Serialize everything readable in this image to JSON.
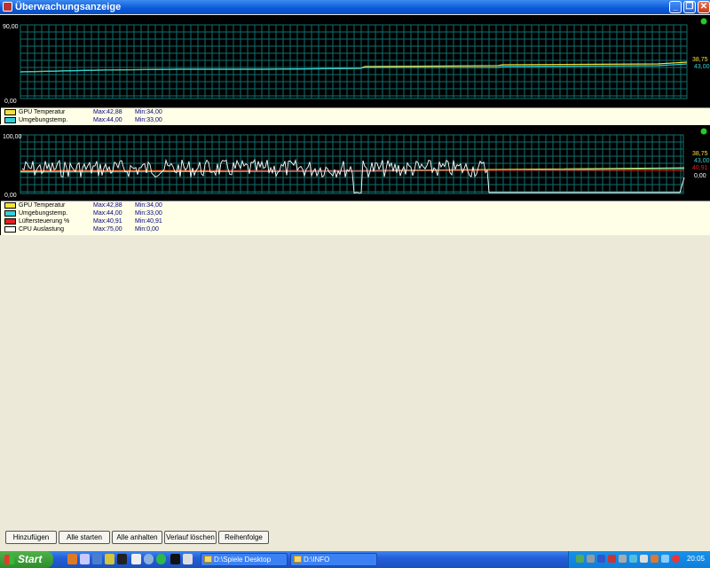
{
  "window": {
    "title": "Überwachungsanzeige",
    "minimize_label": "_",
    "restore_label": "❐",
    "close_label": "✕"
  },
  "panel1": {
    "y_max_label": "90,00",
    "y_min_label": "0,00",
    "current_labels": [
      "38,75",
      "43,00"
    ],
    "legend": [
      {
        "name": "GPU Temperatur",
        "max": "Max:42,88",
        "min": "Min:34,00",
        "color": "#f5e13a"
      },
      {
        "name": "Umgebungstemp.",
        "max": "Max:44,00",
        "min": "Min:33,00",
        "color": "#2fd0d8"
      }
    ]
  },
  "panel2": {
    "y_max_label": "100,00",
    "y_min_label": "0,00",
    "current_labels": [
      "38,75",
      "43,00",
      "40,91",
      "0,00"
    ],
    "legend": [
      {
        "name": "GPU Temperatur",
        "max": "Max:42,88",
        "min": "Min:34,00",
        "color": "#f5e13a"
      },
      {
        "name": "Umgebungstemp.",
        "max": "Max:44,00",
        "min": "Min:33,00",
        "color": "#2fd0d8"
      },
      {
        "name": "Lüftersteuerung %",
        "max": "Max:40,91",
        "min": "Min:40,91",
        "color": "#e02020"
      },
      {
        "name": "CPU Auslastung",
        "max": "Max:75,00",
        "min": "Min:0,00",
        "color": "#ffffff"
      }
    ]
  },
  "buttons": {
    "add": "Hinzufügen",
    "start_all": "Alle starten",
    "stop_all": "Alle anhalten",
    "clear_history": "Verlauf löschen",
    "order": "Reihenfolge"
  },
  "taskbar": {
    "start_label": "Start",
    "task1": "D:\\Spiele Desktop",
    "task2": "D:\\INFO",
    "clock": "20:05"
  },
  "colors": {
    "grid": "#0f6f6f",
    "gpu": "#f5e13a",
    "ambient": "#2fd0d8",
    "fan": "#e02020",
    "cpu": "#ffffff",
    "status_dot": "#22cc22"
  }
}
